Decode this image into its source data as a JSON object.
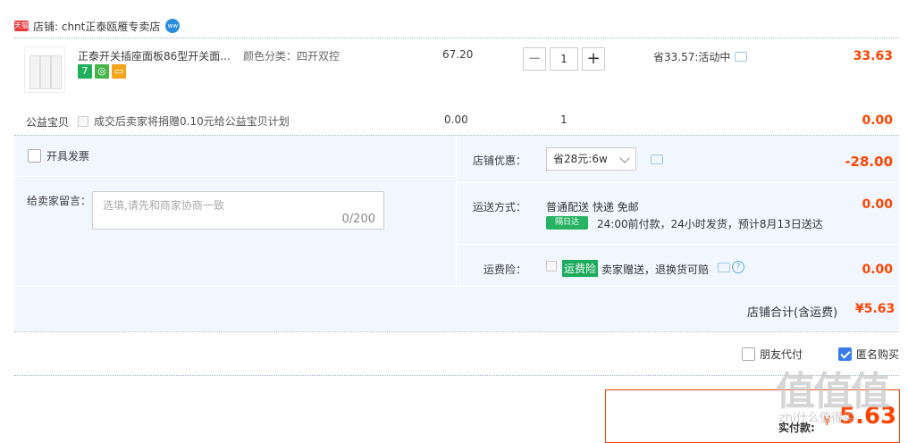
{
  "shop": {
    "tag": "天猫",
    "label": "店铺: chnt正泰瓯雁专卖店",
    "ww_icon": "wangwang-icon"
  },
  "item": {
    "title": "正泰开关插座面板86型开关面...",
    "sku": "颜色分类：四开双控",
    "badges": [
      {
        "text": "7",
        "color": "#1fae5c"
      },
      {
        "text": "◎",
        "color": "#48b548"
      },
      {
        "text": "▭",
        "color": "#f2a51a"
      }
    ],
    "price": "67.20",
    "quantity": "1",
    "save": "省33.57:活动中",
    "subtotal": "33.63"
  },
  "charity": {
    "label": "公益宝贝",
    "desc": "成交后卖家将捐赠0.10元给公益宝贝计划",
    "price": "0.00",
    "qty": "1",
    "subtotal": "0.00"
  },
  "invoice": {
    "label": "开具发票"
  },
  "message": {
    "label": "给卖家留言：",
    "placeholder": "选填,请先和商家协商一致",
    "count": "0/200"
  },
  "discount": {
    "label": "店铺优惠：",
    "selected": "省28元:6w",
    "amount": "-28.00"
  },
  "shipping": {
    "label": "运送方式：",
    "method": "普通配送 快递 免邮",
    "tag": "隔日达",
    "time": "24:00前付款，24小时发货，预计8月13日送达",
    "amount": "0.00"
  },
  "insurance": {
    "label": "运费险：",
    "tag": "运费险",
    "desc": "卖家赠送，退换货可赔",
    "amount": "0.00"
  },
  "total": {
    "label": "店铺合计(含运费)",
    "value": "¥5.63"
  },
  "options": {
    "friend_pay": "朋友代付",
    "anonymous": "匿名购买"
  },
  "pay": {
    "label": "实付款:",
    "currency": "¥",
    "value": "5.63"
  },
  "watermark": {
    "big": "值值值",
    "small": "zhi什么值得买"
  }
}
